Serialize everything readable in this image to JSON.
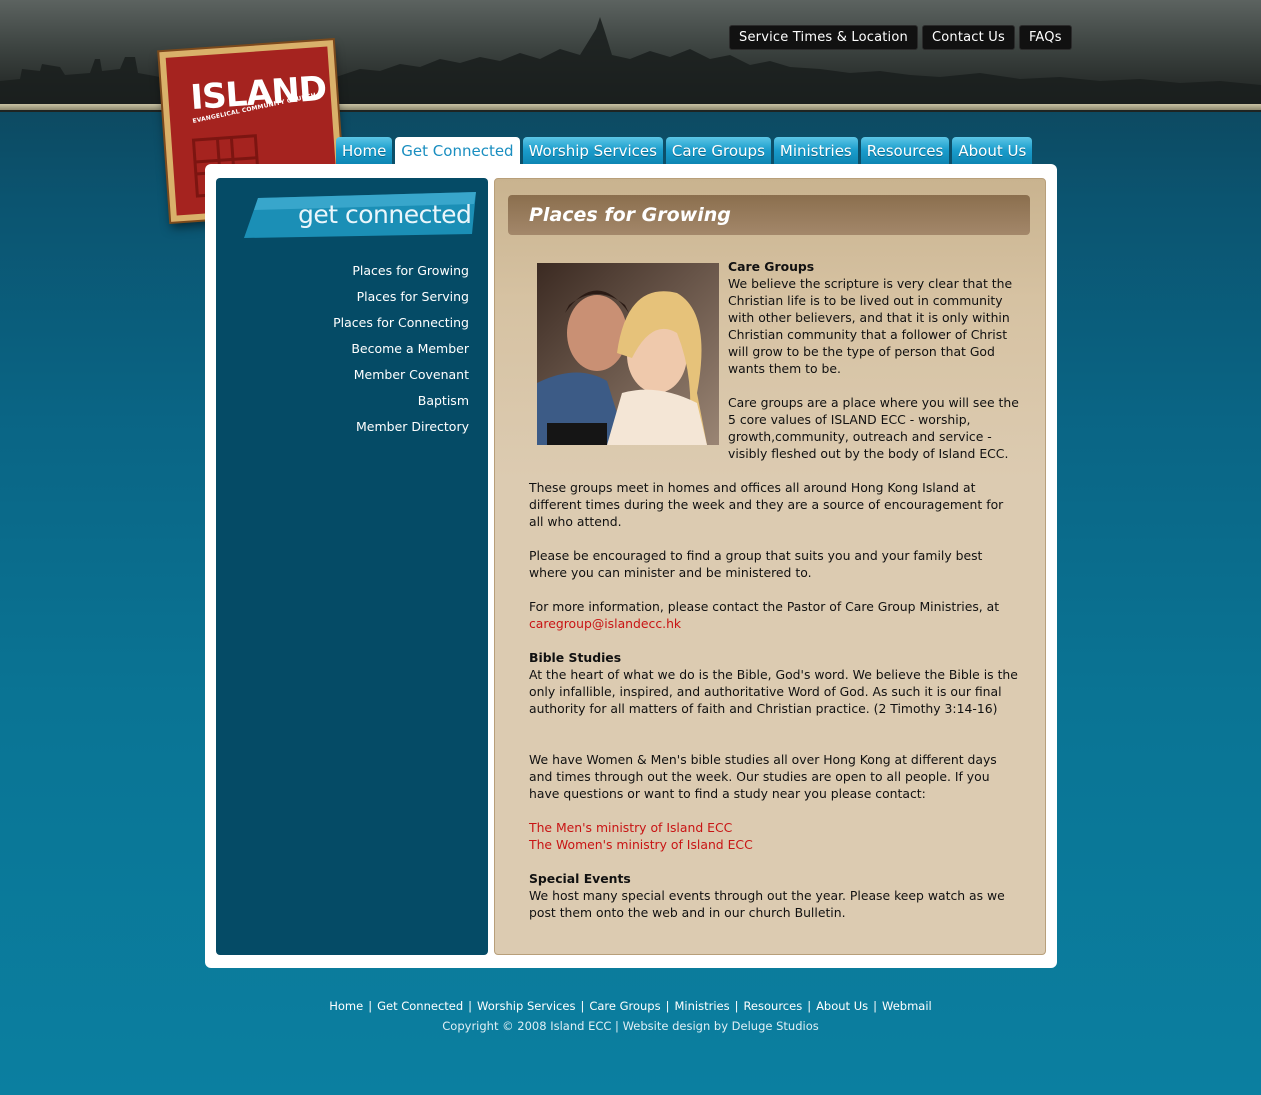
{
  "top_links": [
    "Service Times & Location",
    "Contact Us",
    "FAQs"
  ],
  "logo": {
    "title": "ISLAND",
    "subtitle": "EVANGELICAL COMMUNITY CHURCH"
  },
  "nav": {
    "tabs": [
      "Home",
      "Get Connected",
      "Worship Services",
      "Care Groups",
      "Ministries",
      "Resources",
      "About Us"
    ],
    "active": "Get Connected"
  },
  "sidebar": {
    "banner": "get connected",
    "items": [
      "Places for Growing",
      "Places for Serving",
      "Places for Connecting",
      "Become a Member",
      "Member Covenant",
      "Baptism",
      "Member Directory"
    ]
  },
  "content": {
    "title": "Places for Growing",
    "care_groups_heading": "Care Groups",
    "care_groups_p1": "We believe the scripture is very clear that the Christian life is to be lived out in community with other believers, and that it is only within Christian community that a follower of Christ will grow to be the type of person that God wants them to be.",
    "care_groups_p2": "Care groups are a place where you will see the 5 core values of ISLAND ECC - worship, growth,community, outreach and service - visibly fleshed out by the body of Island ECC.",
    "care_groups_p3": "These groups meet in homes and offices all around Hong Kong Island at different times during the week and they are a source of encouragement for all who attend.",
    "care_groups_p4": "Please be encouraged to find a group that suits you and your family best where you can minister and be ministered to.",
    "care_groups_p5": "For more information, please contact the Pastor of Care Group Ministries, at",
    "care_groups_email": "caregroup@islandecc.hk",
    "bible_heading": "Bible Studies",
    "bible_p1": "At the heart of what we do is the Bible, God's word. We believe the Bible is the only infallible, inspired, and authoritative Word of God. As such it is our final authority for all matters of faith and Christian practice. (2 Timothy 3:14-16)",
    "bible_p2": "We have Women & Men's bible studies all over Hong Kong at different days and times through out the week. Our studies are open to all people. If you have questions or want to find a study near you please contact:",
    "mens_link": "The Men's ministry of Island ECC",
    "womens_link": "The Women's ministry of Island ECC",
    "events_heading": "Special Events",
    "events_p1": "We host many special events through out the year. Please keep watch as we post them onto the web and in our church Bulletin."
  },
  "footer": {
    "links": [
      "Home",
      "Get Connected",
      "Worship Services",
      "Care Groups",
      "Ministries",
      "Resources",
      "About Us",
      "Webmail"
    ],
    "copyright": "Copyright © 2008 Island ECC | Website design by Deluge Studios"
  },
  "colors": {
    "accent_link": "#c81414",
    "sidebar_bg": "#054b66",
    "tab_blue": "#1a9ccb"
  }
}
